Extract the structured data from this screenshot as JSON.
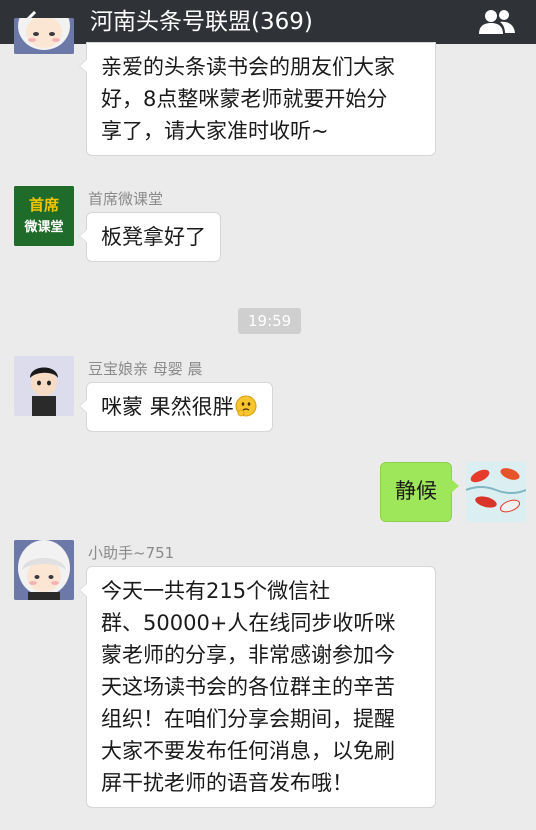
{
  "header": {
    "title": "河南头条号联盟(369)",
    "back_icon": "arrow-left-icon",
    "members_icon": "group-members-icon"
  },
  "messages": [
    {
      "side": "left",
      "lines": [
        "亲爱的头条读书会的朋友们大家",
        "好，8点整咪蒙老师就要开始分",
        "享了，请大家准时收听~"
      ]
    },
    {
      "side": "left",
      "sender": "首席微课堂",
      "avatar_text": [
        "首席",
        "微课堂"
      ],
      "text": "板凳拿好了"
    },
    {
      "side": "left",
      "sender": "豆宝娘亲 母婴 晨",
      "text": "咪蒙 果然很胖",
      "emoji": "thinking-emoji"
    },
    {
      "side": "right",
      "text": "静候"
    },
    {
      "side": "left",
      "sender": "小助手~751",
      "lines": [
        "今天一共有215个微信社",
        "群、50000+人在线同步收听咪",
        "蒙老师的分享，非常感谢参加今",
        "天这场读书会的各位群主的辛苦",
        "组织！在咱们分享会期间，提醒",
        "大家不要发布任何消息，以免刷",
        "屏干扰老师的语音发布哦！"
      ]
    }
  ],
  "timestamp": "19:59",
  "colors": {
    "topbar": "#2f3236",
    "background": "#ebebeb",
    "self_bubble": "#9fe75a",
    "other_bubble": "#ffffff",
    "logo_green": "#1f6b2a",
    "logo_yellow": "#f5c400"
  }
}
